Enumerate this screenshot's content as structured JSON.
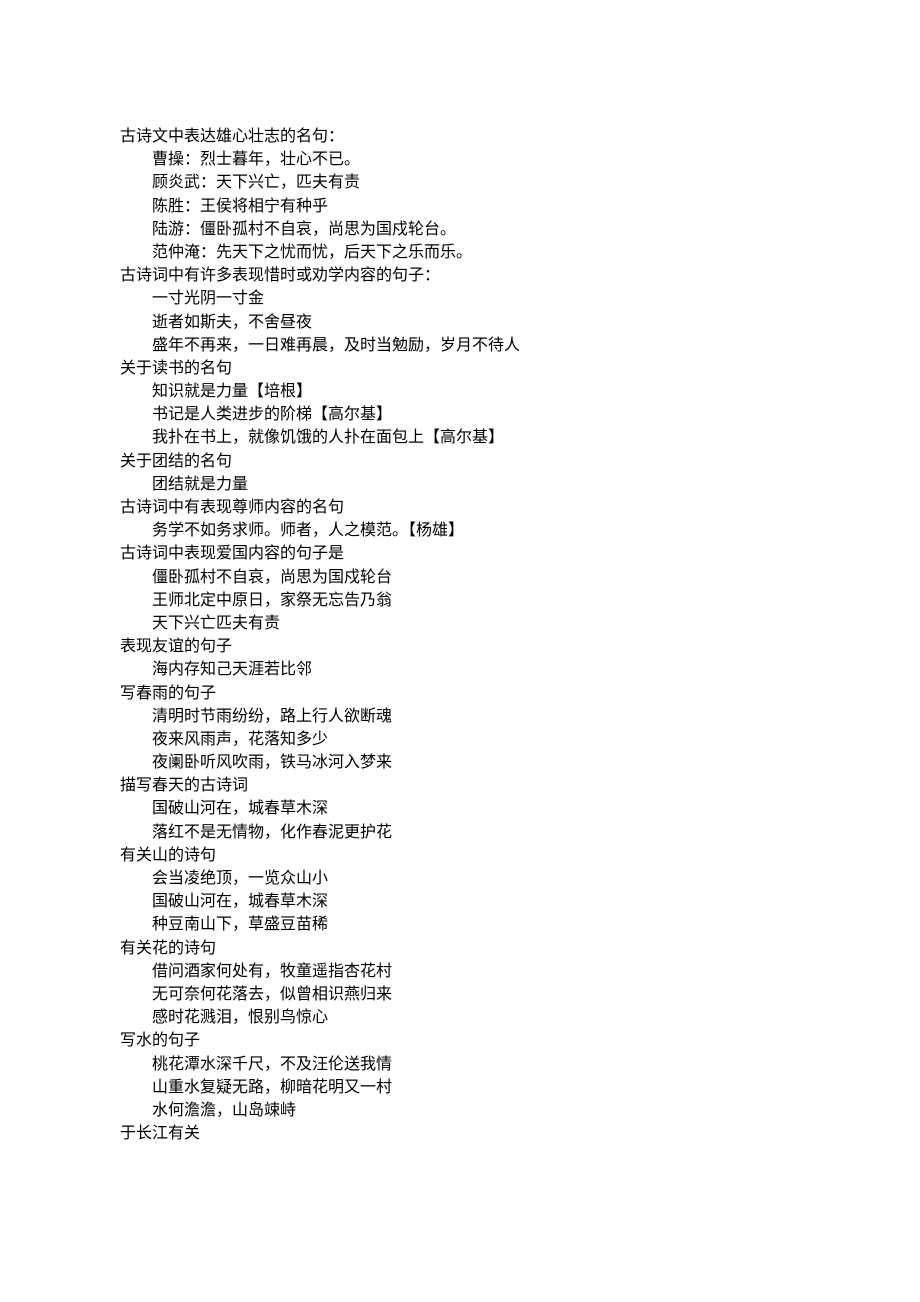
{
  "sections": [
    {
      "heading": "古诗文中表达雄心壮志的名句：",
      "items": [
        "曹操：烈士暮年，壮心不已。",
        "顾炎武：天下兴亡，匹夫有责",
        "陈胜：王侯将相宁有种乎",
        "陆游：僵卧孤村不自哀，尚思为国戍轮台。",
        "范仲淹：先天下之忧而忧，后天下之乐而乐。"
      ]
    },
    {
      "heading": "古诗词中有许多表现惜时或劝学内容的句子：",
      "items": [
        "一寸光阴一寸金",
        "逝者如斯夫，不舍昼夜",
        "盛年不再来，一日难再晨，及时当勉励，岁月不待人"
      ]
    },
    {
      "heading": "关于读书的名句",
      "items": [
        "知识就是力量【培根】",
        "书记是人类进步的阶梯【高尔基】",
        "我扑在书上，就像饥饿的人扑在面包上【高尔基】"
      ]
    },
    {
      "heading": "关于团结的名句",
      "items": [
        "团结就是力量"
      ]
    },
    {
      "heading": "古诗词中有表现尊师内容的名句",
      "items": [
        "务学不如务求师。师者，人之模范。【杨雄】"
      ]
    },
    {
      "heading": "古诗词中表现爱国内容的句子是",
      "items": [
        "僵卧孤村不自哀，尚思为国戍轮台",
        "王师北定中原日，家祭无忘告乃翁",
        "天下兴亡匹夫有责"
      ]
    },
    {
      "heading": "表现友谊的句子",
      "items": [
        "海内存知己天涯若比邻"
      ]
    },
    {
      "heading": "写春雨的句子",
      "items": [
        "清明时节雨纷纷，路上行人欲断魂",
        "夜来风雨声，花落知多少",
        "夜阑卧听风吹雨，铁马冰河入梦来"
      ]
    },
    {
      "heading": "描写春天的古诗词",
      "items": [
        "国破山河在，城春草木深",
        "落红不是无情物，化作春泥更护花"
      ]
    },
    {
      "heading": "有关山的诗句",
      "items": [
        "会当凌绝顶，一览众山小",
        "国破山河在，城春草木深",
        "种豆南山下，草盛豆苗稀"
      ]
    },
    {
      "heading": "有关花的诗句",
      "items": [
        "借问酒家何处有，牧童遥指杏花村",
        "无可奈何花落去，似曾相识燕归来",
        "感时花溅泪，恨别鸟惊心"
      ]
    },
    {
      "heading": "写水的句子",
      "items": [
        "桃花潭水深千尺，不及汪伦送我情",
        "山重水复疑无路，柳暗花明又一村",
        "水何澹澹，山岛竦峙"
      ]
    },
    {
      "heading": "于长江有关",
      "items": []
    }
  ]
}
